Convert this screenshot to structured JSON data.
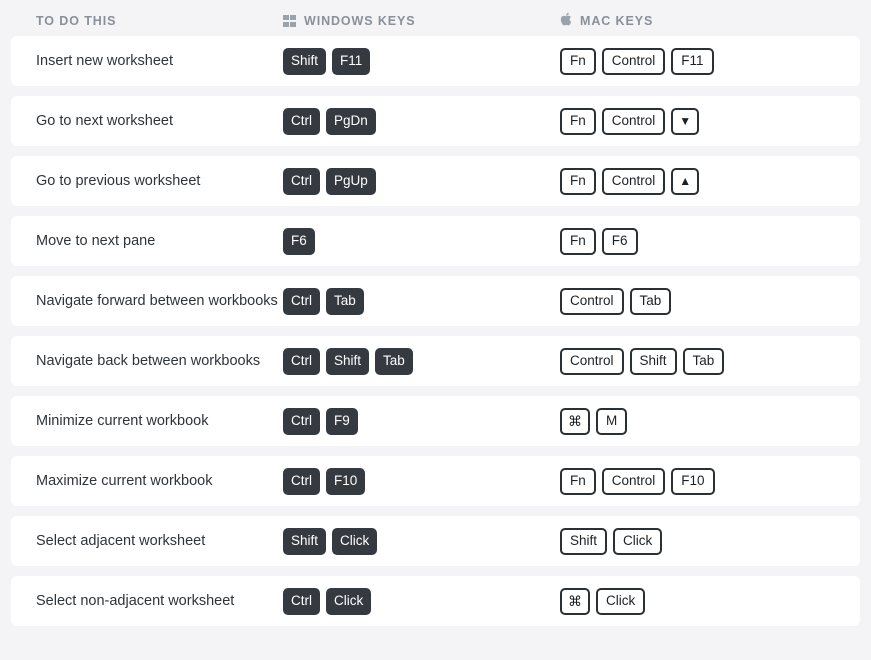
{
  "header": {
    "task_label": "TO DO THIS",
    "windows_label": "WINDOWS KEYS",
    "mac_label": "MAC KEYS",
    "windows_icon": "windows-logo-icon",
    "mac_icon": "apple-logo-icon",
    "apple_glyph": ""
  },
  "colors": {
    "page_background": "#f4f4f6",
    "row_background": "#ffffff",
    "win_key_fill": "#343a40",
    "mac_key_border": "#2b3035",
    "header_text": "#8a9099",
    "task_text": "#2f3439"
  },
  "rows": [
    {
      "task": "Insert new worksheet",
      "windows": [
        "Shift",
        "F11"
      ],
      "mac": [
        "Fn",
        "Control",
        "F11"
      ]
    },
    {
      "task": "Go to next worksheet",
      "windows": [
        "Ctrl",
        "PgDn"
      ],
      "mac": [
        "Fn",
        "Control",
        "▼"
      ]
    },
    {
      "task": "Go to previous worksheet",
      "windows": [
        "Ctrl",
        "PgUp"
      ],
      "mac": [
        "Fn",
        "Control",
        "▲"
      ]
    },
    {
      "task": "Move to next pane",
      "windows": [
        "F6"
      ],
      "mac": [
        "Fn",
        "F6"
      ]
    },
    {
      "task": "Navigate forward between workbooks",
      "windows": [
        "Ctrl",
        "Tab"
      ],
      "mac": [
        "Control",
        "Tab"
      ]
    },
    {
      "task": "Navigate back between workbooks",
      "windows": [
        "Ctrl",
        "Shift",
        "Tab"
      ],
      "mac": [
        "Control",
        "Shift",
        "Tab"
      ]
    },
    {
      "task": "Minimize current workbook",
      "windows": [
        "Ctrl",
        "F9"
      ],
      "mac": [
        "⌘",
        "M"
      ]
    },
    {
      "task": "Maximize current workbook",
      "windows": [
        "Ctrl",
        "F10"
      ],
      "mac": [
        "Fn",
        "Control",
        "F10"
      ]
    },
    {
      "task": "Select adjacent worksheet",
      "windows": [
        "Shift",
        "Click"
      ],
      "mac": [
        "Shift",
        "Click"
      ]
    },
    {
      "task": "Select non-adjacent worksheet",
      "windows": [
        "Ctrl",
        "Click"
      ],
      "mac": [
        "⌘",
        "Click"
      ]
    }
  ]
}
